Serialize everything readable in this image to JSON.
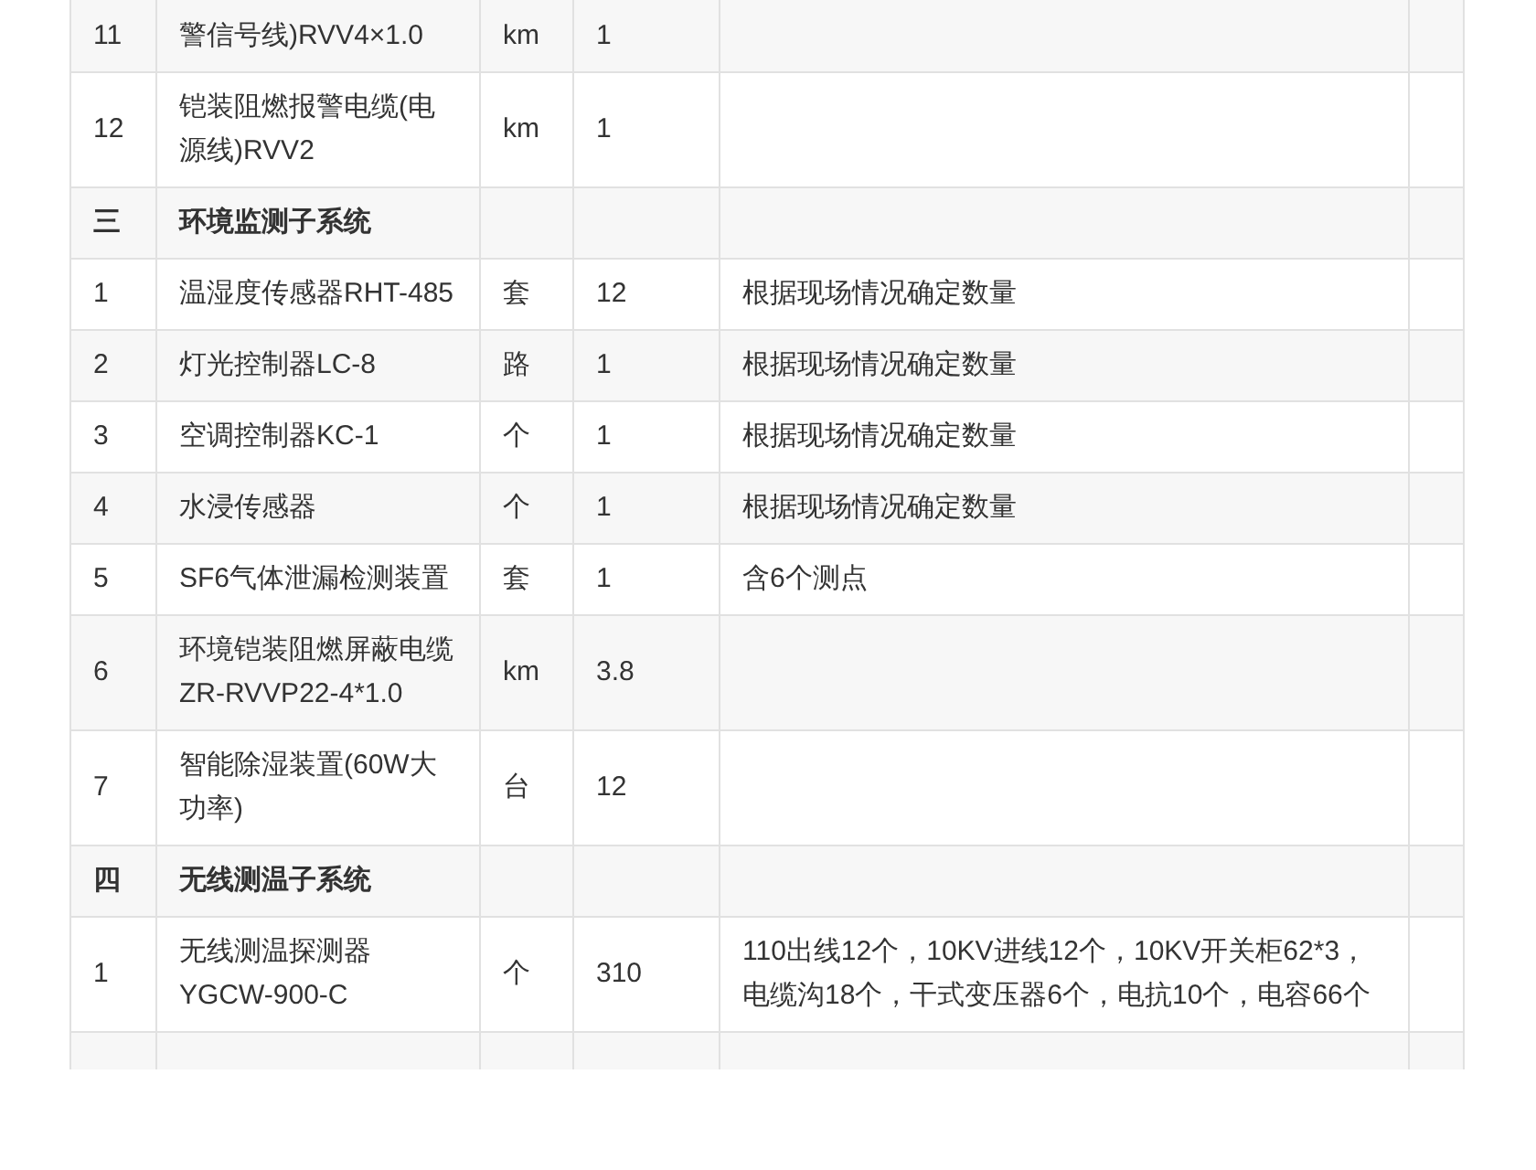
{
  "table": {
    "rows": [
      {
        "kind": "item",
        "cells": [
          "11",
          "警信号线)RVV4×1.0",
          "km",
          "1",
          "",
          ""
        ]
      },
      {
        "kind": "item",
        "cells": [
          "12",
          "铠装阻燃报警电缆(电源线)RVV2",
          "km",
          "1",
          "",
          ""
        ]
      },
      {
        "kind": "section",
        "cells": [
          "三",
          "环境监测子系统",
          "",
          "",
          "",
          ""
        ]
      },
      {
        "kind": "item",
        "cells": [
          "1",
          "温湿度传感器RHT-485",
          "套",
          "12",
          "根据现场情况确定数量",
          ""
        ]
      },
      {
        "kind": "item",
        "cells": [
          "2",
          "灯光控制器LC-8",
          "路",
          "1",
          "根据现场情况确定数量",
          ""
        ]
      },
      {
        "kind": "item",
        "cells": [
          "3",
          "空调控制器KC-1",
          "个",
          "1",
          "根据现场情况确定数量",
          ""
        ]
      },
      {
        "kind": "item",
        "cells": [
          "4",
          "水浸传感器",
          "个",
          "1",
          "根据现场情况确定数量",
          ""
        ]
      },
      {
        "kind": "item",
        "cells": [
          "5",
          "SF6气体泄漏检测装置",
          "套",
          "1",
          "含6个测点",
          ""
        ]
      },
      {
        "kind": "item",
        "cells": [
          "6",
          "环境铠装阻燃屏蔽电缆ZR-RVVP22-4*1.0",
          "km",
          "3.8",
          "",
          ""
        ]
      },
      {
        "kind": "item",
        "cells": [
          "7",
          "智能除湿装置(60W大功率)",
          "台",
          "12",
          "",
          ""
        ]
      },
      {
        "kind": "section",
        "cells": [
          "四",
          "无线测温子系统",
          "",
          "",
          "",
          ""
        ]
      },
      {
        "kind": "item",
        "cells": [
          "1",
          "无线测温探测器YGCW-900-C",
          "个",
          "310",
          "110出线12个，10KV进线12个，10KV开关柜62*3，电缆沟18个，干式变压器6个，电抗10个，电容66个",
          ""
        ]
      }
    ]
  }
}
